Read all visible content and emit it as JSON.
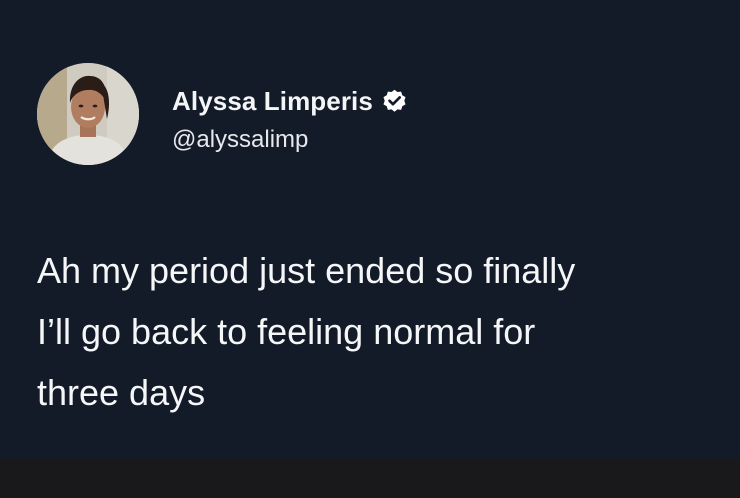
{
  "author": {
    "display_name": "Alyssa Limperis",
    "handle": "@alyssalimp",
    "verified": true,
    "avatar_icon": "profile-photo-avatar",
    "verified_icon": "verified-badge-icon"
  },
  "tweet": {
    "lines": [
      "Ah my period just ended so finally",
      "I’ll go back to feeling normal for",
      "three days"
    ]
  },
  "colors": {
    "background": "#141b28",
    "text": "#ffffff",
    "footer_band": "#19191b"
  }
}
